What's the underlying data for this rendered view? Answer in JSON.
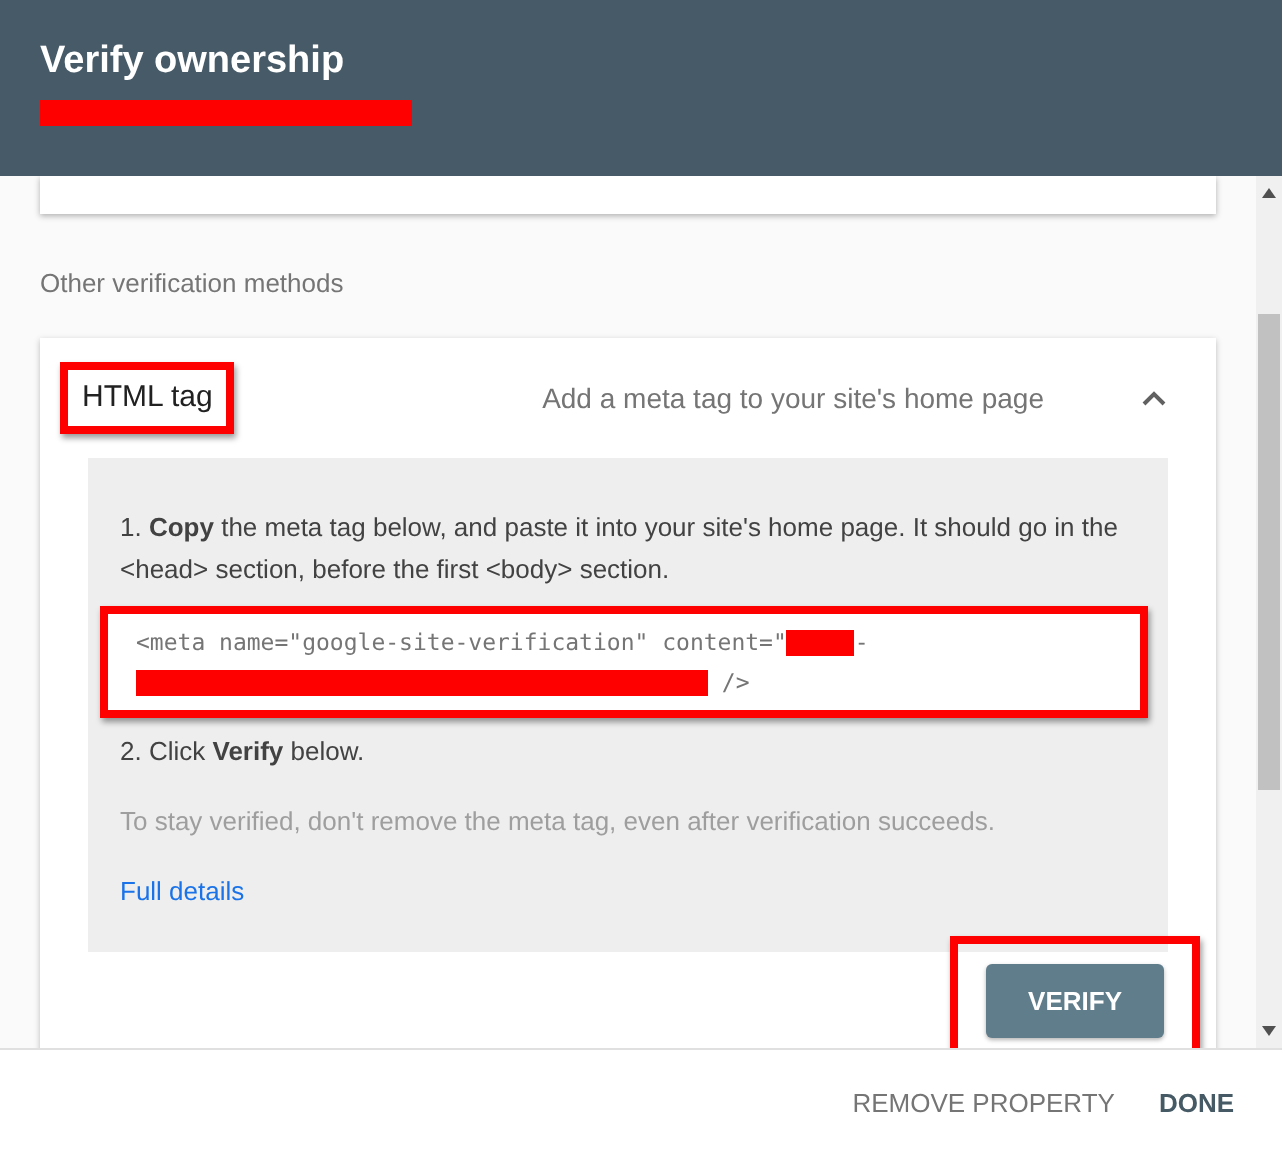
{
  "header": {
    "title": "Verify ownership",
    "subtitle_redacted": true
  },
  "section_label": "Other verification methods",
  "method": {
    "name": "HTML tag",
    "name_highlighted": true,
    "description": "Add a meta tag to your site's home page",
    "expanded": true,
    "step1": "1. **Copy** the meta tag below, and paste it into your site's home page. It should go in the <head> section, before the first <body> section.",
    "code": {
      "line1": "<meta name=\"google-site-verification\" content=\"",
      "line1_end": "-",
      "line2_end": " />",
      "highlighted": true
    },
    "step2": "2. Click **Verify** below.",
    "note": "To stay verified, don't remove the meta tag, even after verification succeeds.",
    "details_link": "Full details",
    "verify_button": {
      "label": "VERIFY",
      "highlighted": true
    }
  },
  "footer": {
    "buttons": [
      {
        "label": "REMOVE PROPERTY",
        "kind": "secondary"
      },
      {
        "label": "DONE",
        "kind": "primary"
      }
    ]
  }
}
